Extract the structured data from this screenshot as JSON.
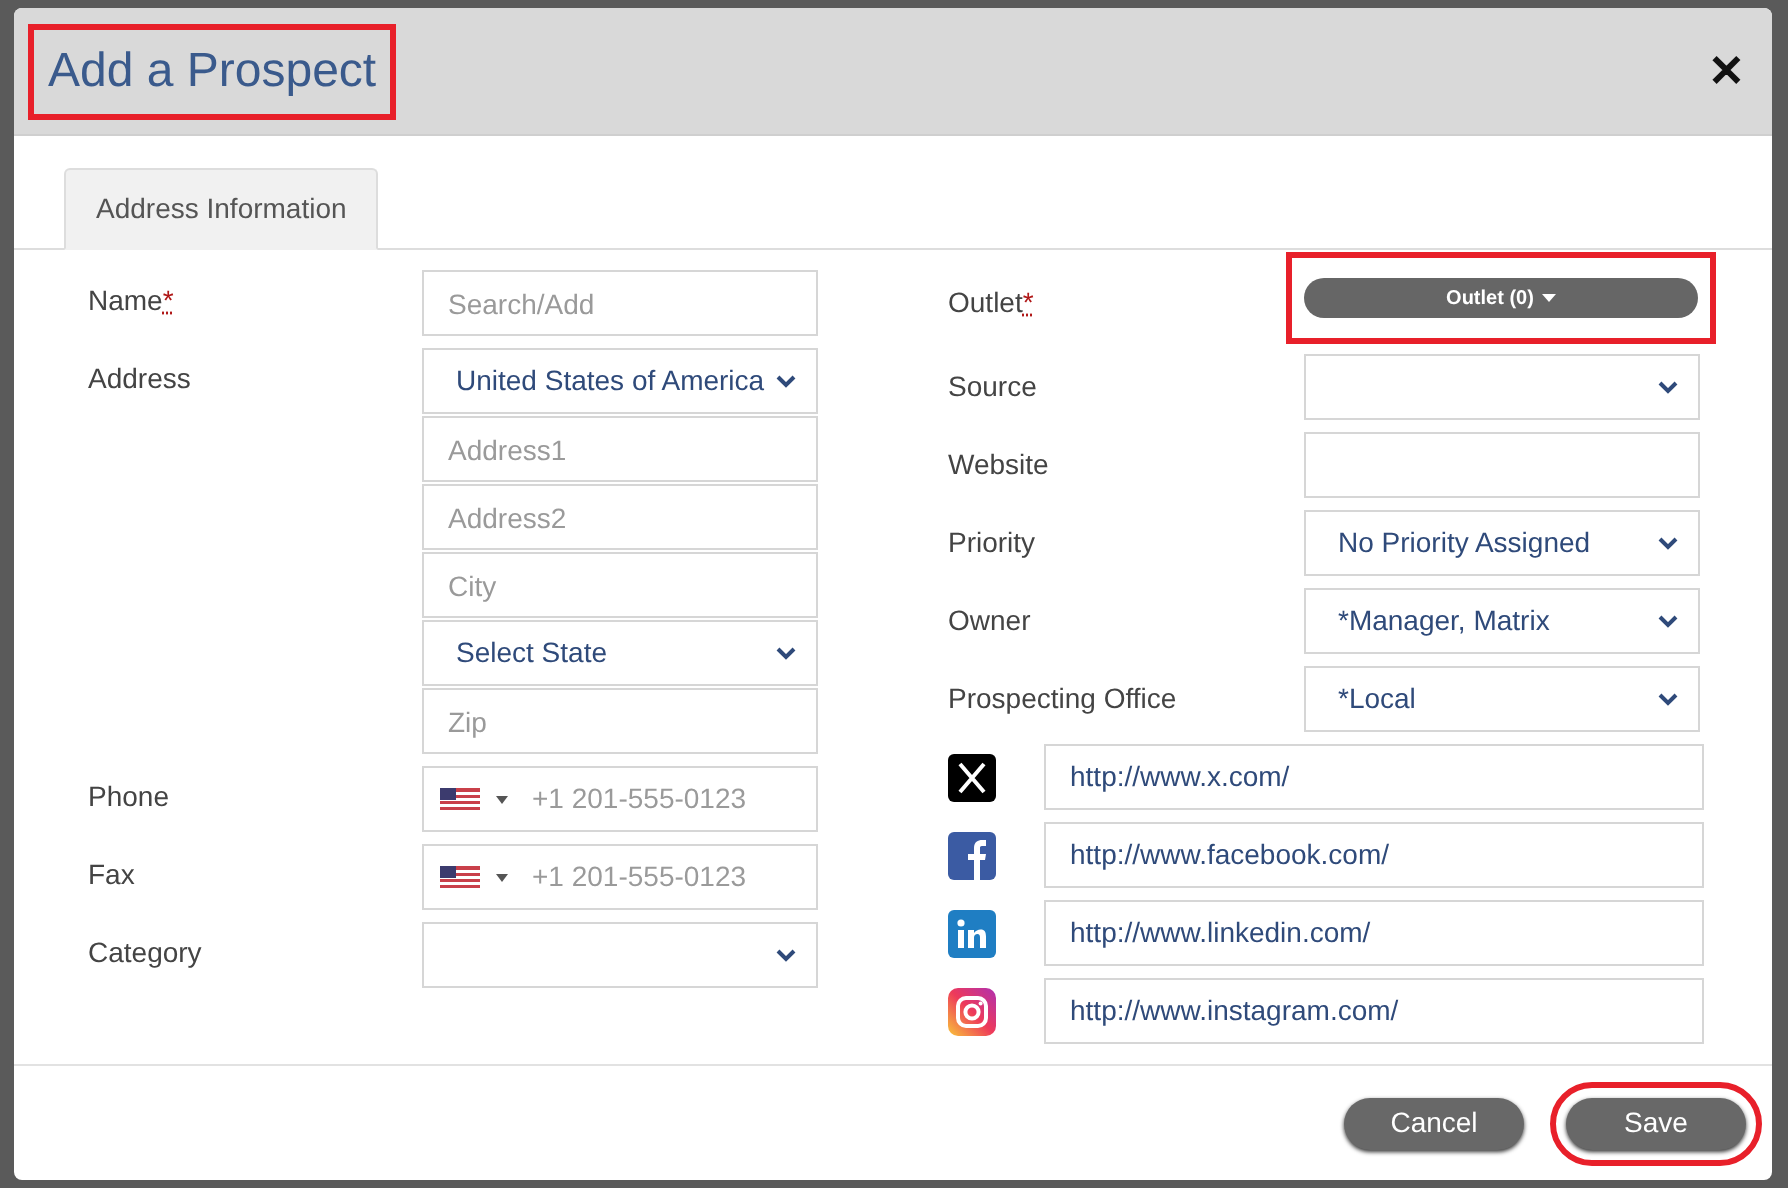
{
  "dialog": {
    "title": "Add a Prospect",
    "title_highlighted": true,
    "close_label": "✕"
  },
  "tabs": [
    {
      "label": "Address Information",
      "selected": true
    }
  ],
  "left_fields": [
    {
      "label": "Name",
      "required_mark": "*",
      "inputs": [
        {
          "kind": "text",
          "placeholder": "Search/Add"
        }
      ]
    },
    {
      "label": "Address",
      "inputs": [
        {
          "kind": "select",
          "value": "United States of America"
        },
        {
          "kind": "text",
          "placeholder": "Address1"
        },
        {
          "kind": "text",
          "placeholder": "Address2"
        },
        {
          "kind": "text",
          "placeholder": "City"
        },
        {
          "kind": "select",
          "value": "Select State"
        },
        {
          "kind": "text",
          "placeholder": "Zip"
        }
      ]
    },
    {
      "label": "Phone",
      "inputs": [
        {
          "kind": "phone",
          "placeholder": "+1 201-555-0123"
        }
      ]
    },
    {
      "label": "Fax",
      "inputs": [
        {
          "kind": "phone",
          "placeholder": "+1 201-555-0123"
        }
      ]
    },
    {
      "label": "Category",
      "inputs": [
        {
          "kind": "select"
        }
      ]
    }
  ],
  "right_fields": [
    {
      "label": "Outlet",
      "required_mark": "*",
      "input": {
        "kind": "menu_button",
        "value": "Outlet (0)",
        "highlighted": true
      }
    },
    {
      "label": "Source",
      "input": {
        "kind": "select"
      }
    },
    {
      "label": "Website",
      "input": {
        "kind": "text"
      }
    },
    {
      "label": "Priority",
      "input": {
        "kind": "select",
        "value": "No Priority Assigned"
      }
    },
    {
      "label": "Owner",
      "input": {
        "kind": "select",
        "value": "*Manager, Matrix"
      }
    },
    {
      "label": "Prospecting Office",
      "input": {
        "kind": "select",
        "value": "*Local"
      }
    }
  ],
  "social_links": [
    {
      "kind": "x",
      "value": "http://www.x.com/"
    },
    {
      "kind": "facebook",
      "value": "http://www.facebook.com/"
    },
    {
      "kind": "linkedin",
      "value": "http://www.linkedin.com/"
    },
    {
      "kind": "instagram",
      "value": "http://www.instagram.com/"
    }
  ],
  "buttons": [
    {
      "label": "Cancel",
      "highlighted": false
    },
    {
      "label": "Save",
      "highlighted": true
    }
  ]
}
